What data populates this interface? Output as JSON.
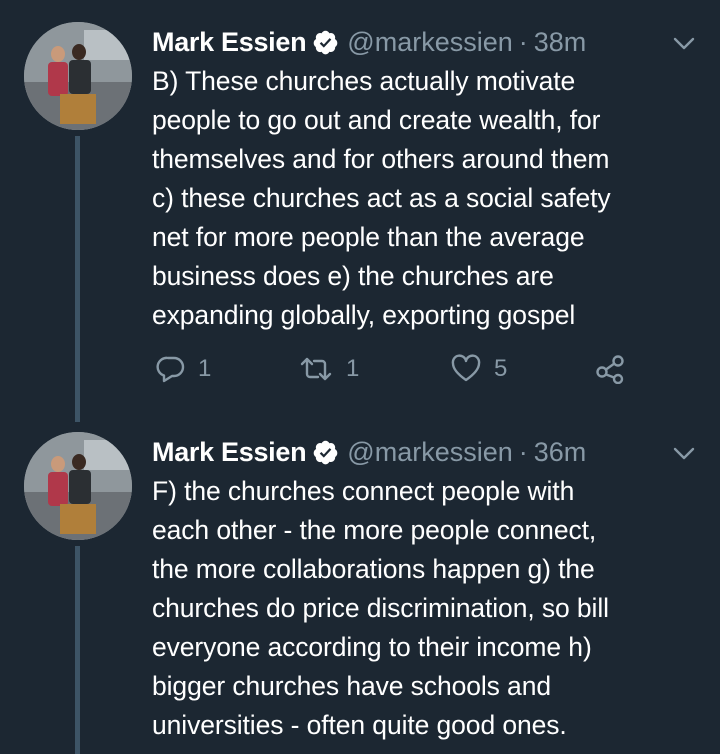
{
  "tweets": [
    {
      "name": "Mark Essien",
      "handle": "@markessien",
      "separator": "·",
      "time": "38m",
      "lines": [
        "B) These churches actually motivate",
        "people to go out and create wealth, for",
        "themselves and for others around them",
        "c) these churches act as a social safety",
        "net for more people than the average",
        "business does e) the churches are",
        "expanding globally, exporting gospel"
      ],
      "replies": "1",
      "retweets": "1",
      "likes": "5"
    },
    {
      "name": "Mark Essien",
      "handle": "@markessien",
      "separator": "·",
      "time": "36m",
      "lines": [
        "F) the churches connect people with",
        "each other - the more people connect,",
        "the more collaborations happen g) the",
        "churches do price discrimination, so bill",
        "everyone according to their income h)",
        "bigger churches have schools and",
        "universities - often quite good ones."
      ]
    }
  ],
  "colors": {
    "background": "#1c2732",
    "text": "#ffffff",
    "secondary": "#8899a6",
    "thread_line": "#3d5466",
    "verified": "#ffffff"
  },
  "icons": [
    "verified-badge-icon",
    "chevron-down-icon",
    "reply-icon",
    "retweet-icon",
    "like-icon",
    "share-icon"
  ]
}
